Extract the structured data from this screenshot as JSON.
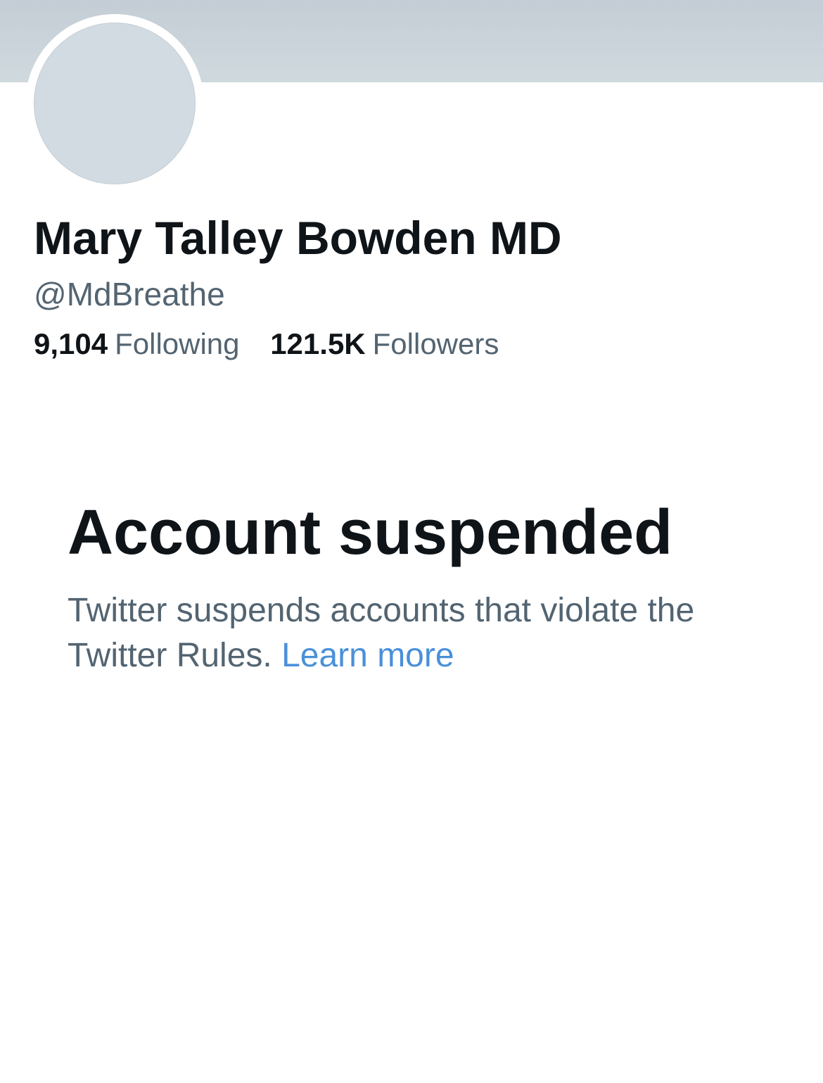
{
  "profile": {
    "display_name": "Mary Talley Bowden MD",
    "handle": "@MdBreathe",
    "following_count": "9,104",
    "following_label": "Following",
    "followers_count": "121.5K",
    "followers_label": "Followers"
  },
  "suspension": {
    "title": "Account suspended",
    "message": "Twitter suspends accounts that violate the Twitter Rules.",
    "link_label": "Learn more"
  },
  "colors": {
    "banner": "#cfd9de",
    "avatar_placeholder": "#d2dbe1",
    "primary_text": "#0f1419",
    "secondary_text": "#536471",
    "link": "#4a90d9"
  }
}
